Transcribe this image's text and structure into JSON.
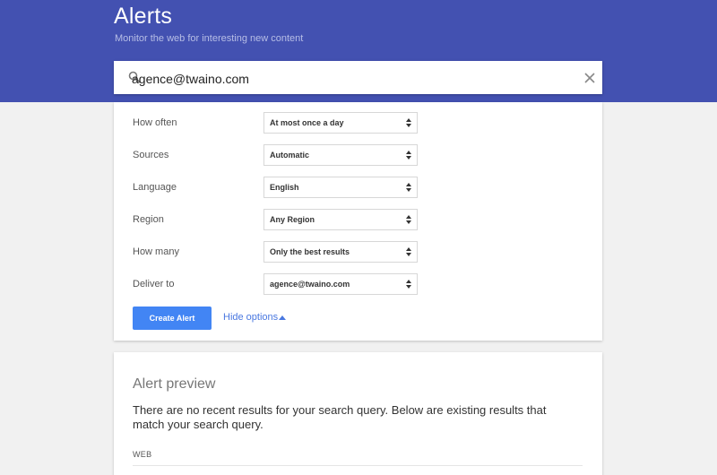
{
  "header": {
    "title": "Alerts",
    "subtitle": "Monitor the web for interesting new content"
  },
  "search": {
    "value": "agence@twaino.com",
    "search_icon": "search-icon",
    "clear_icon": "close-icon"
  },
  "options": [
    {
      "label": "How often",
      "value": "At most once a day"
    },
    {
      "label": "Sources",
      "value": "Automatic"
    },
    {
      "label": "Language",
      "value": "English"
    },
    {
      "label": "Region",
      "value": "Any Region"
    },
    {
      "label": "How many",
      "value": "Only the best results"
    },
    {
      "label": "Deliver to",
      "value": "agence@twaino.com"
    }
  ],
  "actions": {
    "create_label": "Create Alert",
    "hide_options_label": "Hide options"
  },
  "preview": {
    "title": "Alert preview",
    "message": "There are no recent results for your search query. Below are existing results that match your search query.",
    "section_label": "WEB"
  },
  "colors": {
    "header_bg": "#4351b1",
    "primary_button": "#4285f4",
    "link": "#4a78e0"
  }
}
